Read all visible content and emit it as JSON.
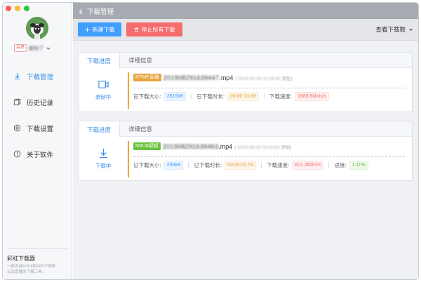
{
  "sidebar": {
    "user": {
      "member_badge": "会员",
      "name": "删除了"
    },
    "nav": [
      {
        "label": "下载管理",
        "icon": "download-icon"
      },
      {
        "label": "历史记录",
        "icon": "history-icon"
      },
      {
        "label": "下载设置",
        "icon": "settings-icon"
      },
      {
        "label": "关于软件",
        "icon": "info-icon"
      }
    ],
    "footer": {
      "app_name": "彩虹下载器",
      "desc_line1": "一款支持M3U8和RMTP视频",
      "desc_line2": "以及直播的下载工具。"
    }
  },
  "topbar": {
    "title": "下载管理"
  },
  "toolbar": {
    "new_label": "新建下载",
    "stop_all_label": "停止所有下载",
    "view_count_label": "查看下载数"
  },
  "tasks": [
    {
      "tab_progress": "下载进度",
      "tab_detail": "详细信息",
      "status": "录制中",
      "type_badge": "RTMP直播",
      "file_name_blur": "201908291639447",
      "file_ext": ".mp4",
      "added_time": "2019-08-29 15:29:45",
      "added_label": "添加",
      "size_label": "已下载大小:",
      "size": "2816kB",
      "duration_label": "已下载时长:",
      "duration": "00:00:13.68",
      "speed_label": "下载速度:",
      "speed": "1685.6kbits/s"
    },
    {
      "tab_progress": "下载进度",
      "tab_detail": "详细信息",
      "status": "下载中",
      "type_badge": "M3U8视频",
      "file_name_blur": "201908291639463",
      "file_ext": ".mp4",
      "added_time": "2019-08-29 15:30:53",
      "added_label": "添加",
      "size_label": "已下载大小:",
      "size": "256kB",
      "duration_label": "已下载时长:",
      "duration": "00:00:02.55",
      "speed_label": "下载速度:",
      "speed": "821.2kbits/s",
      "progress_label": "进度:",
      "progress": "1.11%"
    }
  ],
  "colors": {
    "accent": "#409eff",
    "danger": "#f56c6c",
    "warning": "#e6a23c",
    "success": "#67c23a",
    "topbar": "#a7aab1"
  }
}
